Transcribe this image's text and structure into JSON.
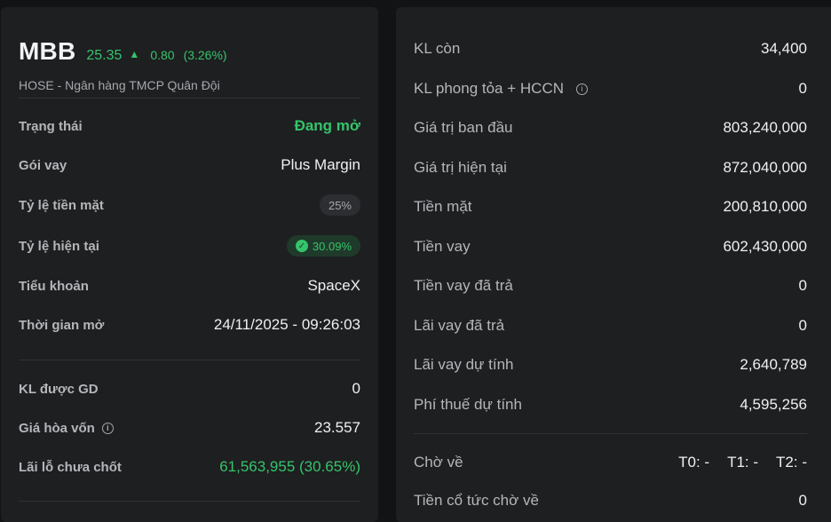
{
  "stock": {
    "ticker": "MBB",
    "price": "25.35",
    "change": "0.80",
    "change_pct": "(3.26%)",
    "subtitle": "HOSE - Ngân hàng TMCP Quân Đội"
  },
  "left_rows": [
    {
      "label": "Trạng thái",
      "value": "Đang mở"
    },
    {
      "label": "Gói vay",
      "value": "Plus Margin"
    },
    {
      "label": "Tỷ lệ tiền mặt",
      "value": "25%"
    },
    {
      "label": "Tỷ lệ hiện tại",
      "value": "30.09%"
    },
    {
      "label": "Tiểu khoản",
      "value": "SpaceX"
    },
    {
      "label": "Thời gian mở",
      "value": "24/11/2025 - 09:26:03"
    },
    {
      "label": "KL được GD",
      "value": "0"
    },
    {
      "label": "Giá hòa vốn",
      "value": "23.557"
    },
    {
      "label": "Lãi lỗ chưa chốt",
      "value": "61,563,955 (30.65%)"
    }
  ],
  "right_rows": [
    {
      "label": "KL còn",
      "value": "34,400"
    },
    {
      "label": "KL phong tỏa + HCCN",
      "value": "0"
    },
    {
      "label": "Giá trị ban đầu",
      "value": "803,240,000"
    },
    {
      "label": "Giá trị hiện tại",
      "value": "872,040,000"
    },
    {
      "label": "Tiền mặt",
      "value": "200,810,000"
    },
    {
      "label": "Tiền vay",
      "value": "602,430,000"
    },
    {
      "label": "Tiền vay đã trả",
      "value": "0"
    },
    {
      "label": "Lãi vay đã trả",
      "value": "0"
    },
    {
      "label": "Lãi vay dự tính",
      "value": "2,640,789"
    },
    {
      "label": "Phí thuế dự tính",
      "value": "4,595,256"
    }
  ],
  "pending": {
    "label": "Chờ về",
    "t0": "T0: -",
    "t1": "T1: -",
    "t2": "T2: -"
  },
  "dividend": {
    "label": "Tiền cổ tức chờ về",
    "value": "0"
  },
  "colors": {
    "up": "#35c46b",
    "panel": "#1e1f21",
    "background": "#121314"
  },
  "icons": {
    "up_arrow": "triangle-up-icon",
    "info": "info-icon",
    "check": "check-circle-icon"
  }
}
